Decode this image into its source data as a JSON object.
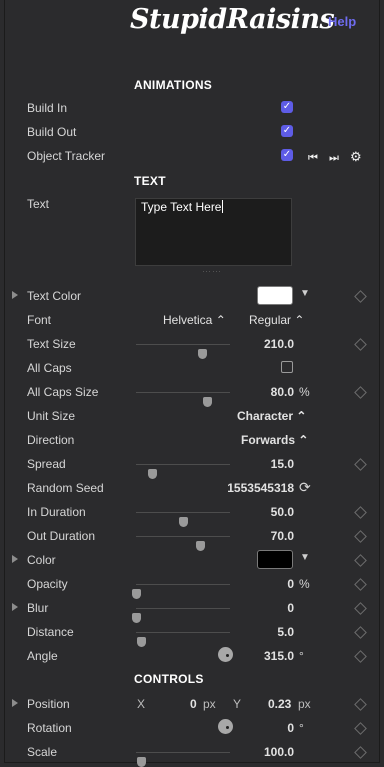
{
  "header": {
    "logo": "StupidRaisins",
    "help": "Help"
  },
  "sections": {
    "animations": "ANIMATIONS",
    "text": "TEXT",
    "controls": "CONTROLS"
  },
  "animations": {
    "build_in": "Build In",
    "build_out": "Build Out",
    "object_tracker": "Object Tracker",
    "check_glyph": "✓",
    "prev_glyph": "⏮",
    "next_glyph": "⏭",
    "gear_glyph": "⚙"
  },
  "text": {
    "label": "Text",
    "value": "Type Text Here"
  },
  "params": {
    "text_color": {
      "label": "Text Color",
      "swatch": "#ffffff"
    },
    "font": {
      "label": "Font",
      "family": "Helvetica ⌃",
      "style": "Regular ⌃"
    },
    "text_size": {
      "label": "Text Size",
      "value": "210.0",
      "level": 0.7
    },
    "all_caps": {
      "label": "All Caps"
    },
    "all_caps_size": {
      "label": "All Caps Size",
      "value": "80.0",
      "unit": "%",
      "level": 0.76
    },
    "unit_size": {
      "label": "Unit Size",
      "value": "Character ⌃"
    },
    "direction": {
      "label": "Direction",
      "value": "Forwards ⌃"
    },
    "spread": {
      "label": "Spread",
      "value": "15.0",
      "level": 0.17
    },
    "random_seed": {
      "label": "Random Seed",
      "value": "1553545318",
      "refresh": "⟳"
    },
    "in_duration": {
      "label": "In Duration",
      "value": "50.0",
      "level": 0.5
    },
    "out_duration": {
      "label": "Out Duration",
      "value": "70.0",
      "level": 0.68
    },
    "color": {
      "label": "Color",
      "swatch": "#000000"
    },
    "opacity": {
      "label": "Opacity",
      "value": "0",
      "unit": "%",
      "level": 0
    },
    "blur": {
      "label": "Blur",
      "value": "0",
      "level": 0
    },
    "distance": {
      "label": "Distance",
      "value": "5.0",
      "level": 0.05
    },
    "angle": {
      "label": "Angle",
      "value": "315.0",
      "unit": "°"
    },
    "position": {
      "label": "Position",
      "x_label": "X",
      "x_value": "0",
      "x_unit": "px",
      "y_label": "Y",
      "y_value": "0.23",
      "y_unit": "px"
    },
    "rotation": {
      "label": "Rotation",
      "value": "0",
      "unit": "°"
    },
    "scale": {
      "label": "Scale",
      "value": "100.0",
      "level": 0.05
    }
  },
  "colors": {
    "accent": "#5e5ce6",
    "help": "#6f6cf0",
    "background": "#2b2b2d"
  }
}
